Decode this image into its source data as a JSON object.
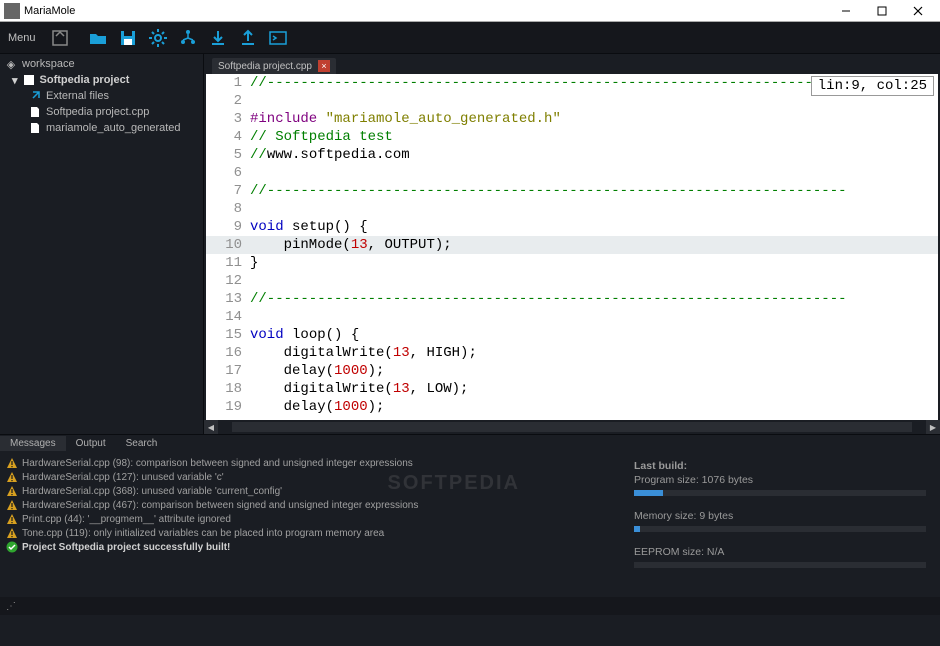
{
  "window": {
    "title": "MariaMole"
  },
  "menubar": {
    "items": [
      "Menu"
    ]
  },
  "toolbar": {
    "buttons": [
      "new-project",
      "open",
      "save",
      "settings",
      "tree-config",
      "download",
      "upload",
      "terminal"
    ]
  },
  "sidebar": {
    "root": "workspace",
    "project": "Softpedia project",
    "external_label": "External files",
    "files": [
      "Softpedia project.cpp",
      "mariamole_auto_generated"
    ]
  },
  "editor": {
    "tab_label": "Softpedia project.cpp",
    "position": "lin:9, col:25",
    "current_line": 10,
    "lines": [
      {
        "n": 1,
        "segments": [
          {
            "cls": "sh-comment",
            "t": "//---------------------------------------------------------------------"
          }
        ]
      },
      {
        "n": 2,
        "segments": []
      },
      {
        "n": 3,
        "segments": [
          {
            "cls": "sh-preproc",
            "t": "#include "
          },
          {
            "cls": "sh-string",
            "t": "\"mariamole_auto_generated.h\""
          }
        ]
      },
      {
        "n": 4,
        "segments": [
          {
            "cls": "sh-comment",
            "t": "// Softpedia test"
          }
        ]
      },
      {
        "n": 5,
        "segments": [
          {
            "cls": "sh-comment",
            "t": "//"
          },
          {
            "cls": "",
            "t": "www.softpedia.com"
          }
        ]
      },
      {
        "n": 6,
        "segments": []
      },
      {
        "n": 7,
        "segments": [
          {
            "cls": "sh-comment",
            "t": "//---------------------------------------------------------------------"
          }
        ]
      },
      {
        "n": 8,
        "segments": []
      },
      {
        "n": 9,
        "segments": [
          {
            "cls": "sh-keyword",
            "t": "void"
          },
          {
            "cls": "",
            "t": " setup"
          },
          {
            "cls": "",
            "t": "() {"
          }
        ]
      },
      {
        "n": 10,
        "segments": [
          {
            "cls": "",
            "t": "    pinMode("
          },
          {
            "cls": "sh-num",
            "t": "13"
          },
          {
            "cls": "",
            "t": ", OUTPUT);"
          }
        ]
      },
      {
        "n": 11,
        "segments": [
          {
            "cls": "",
            "t": "}"
          }
        ]
      },
      {
        "n": 12,
        "segments": []
      },
      {
        "n": 13,
        "segments": [
          {
            "cls": "sh-comment",
            "t": "//---------------------------------------------------------------------"
          }
        ]
      },
      {
        "n": 14,
        "segments": []
      },
      {
        "n": 15,
        "segments": [
          {
            "cls": "sh-keyword",
            "t": "void"
          },
          {
            "cls": "",
            "t": " loop"
          },
          {
            "cls": "",
            "t": "() {"
          }
        ]
      },
      {
        "n": 16,
        "segments": [
          {
            "cls": "",
            "t": "    digitalWrite("
          },
          {
            "cls": "sh-num",
            "t": "13"
          },
          {
            "cls": "",
            "t": ", HIGH);"
          }
        ]
      },
      {
        "n": 17,
        "segments": [
          {
            "cls": "",
            "t": "    delay("
          },
          {
            "cls": "sh-num",
            "t": "1000"
          },
          {
            "cls": "",
            "t": ");"
          }
        ]
      },
      {
        "n": 18,
        "segments": [
          {
            "cls": "",
            "t": "    digitalWrite("
          },
          {
            "cls": "sh-num",
            "t": "13"
          },
          {
            "cls": "",
            "t": ", LOW);"
          }
        ]
      },
      {
        "n": 19,
        "segments": [
          {
            "cls": "",
            "t": "    delay("
          },
          {
            "cls": "sh-num",
            "t": "1000"
          },
          {
            "cls": "",
            "t": ");"
          }
        ]
      }
    ]
  },
  "bottom_tabs": {
    "messages": "Messages",
    "output": "Output",
    "search": "Search"
  },
  "messages": [
    {
      "type": "warn",
      "text": "HardwareSerial.cpp (98):  comparison between signed and unsigned integer expressions"
    },
    {
      "type": "warn",
      "text": "HardwareSerial.cpp (127):  unused variable 'c'"
    },
    {
      "type": "warn",
      "text": "HardwareSerial.cpp (368):  unused variable 'current_config'"
    },
    {
      "type": "warn",
      "text": "HardwareSerial.cpp (467):  comparison between signed and unsigned integer expressions"
    },
    {
      "type": "warn",
      "text": "Print.cpp (44):  '__progmem__' attribute ignored"
    },
    {
      "type": "warn",
      "text": "Tone.cpp (119):  only initialized variables can be placed into program memory area"
    },
    {
      "type": "ok",
      "text": "Project Softpedia project successfully built!"
    }
  ],
  "build": {
    "label": "Last build:",
    "program": "Program size: 1076 bytes",
    "memory": "Memory size: 9 bytes",
    "eeprom": "EEPROM size: N/A"
  },
  "watermark": "SOFTPEDIA",
  "status": {
    "text": ""
  }
}
